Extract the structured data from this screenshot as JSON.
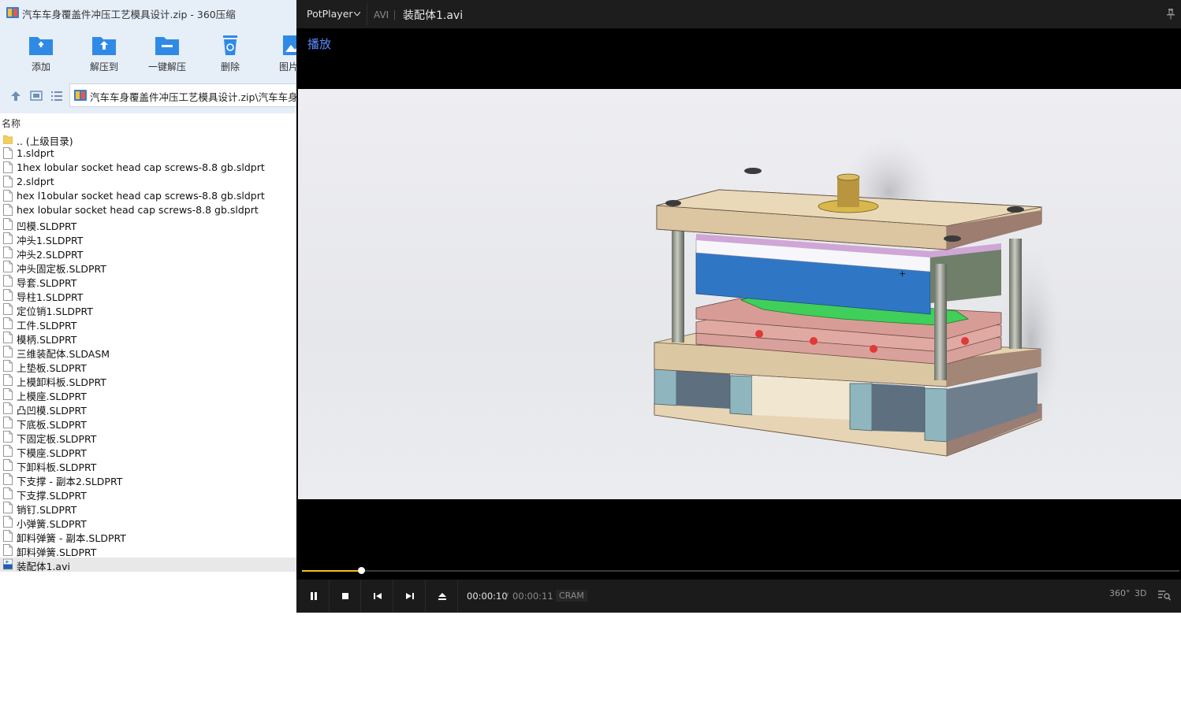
{
  "archive": {
    "title": "汽车车身覆盖件冲压工艺模具设计.zip - 360压缩",
    "toolbar": [
      {
        "label": "添加",
        "icon": "add-folder-icon"
      },
      {
        "label": "解压到",
        "icon": "extract-to-icon"
      },
      {
        "label": "一键解压",
        "icon": "one-click-extract-icon"
      },
      {
        "label": "删除",
        "icon": "delete-icon"
      },
      {
        "label": "图片滤",
        "icon": "image-icon"
      }
    ],
    "path": "汽车车身覆盖件冲压工艺模具设计.zip\\汽车车身覆",
    "column_name": "名称",
    "files": [
      {
        "name": ".. (上级目录)",
        "type": "folder"
      },
      {
        "name": "1.sldprt",
        "type": "file"
      },
      {
        "name": "1hex lobular socket head cap screws-8.8 gb.sldprt",
        "type": "file"
      },
      {
        "name": "2.sldprt",
        "type": "file"
      },
      {
        "name": "hex l1obular socket head cap screws-8.8 gb.sldprt",
        "type": "file"
      },
      {
        "name": "hex lobular socket head cap screws-8.8 gb.sldprt",
        "type": "file"
      },
      {
        "name": "凹模.SLDPRT",
        "type": "file"
      },
      {
        "name": "冲头1.SLDPRT",
        "type": "file"
      },
      {
        "name": "冲头2.SLDPRT",
        "type": "file"
      },
      {
        "name": "冲头固定板.SLDPRT",
        "type": "file"
      },
      {
        "name": "导套.SLDPRT",
        "type": "file"
      },
      {
        "name": "导柱1.SLDPRT",
        "type": "file"
      },
      {
        "name": "定位销1.SLDPRT",
        "type": "file"
      },
      {
        "name": "工件.SLDPRT",
        "type": "file"
      },
      {
        "name": "模柄.SLDPRT",
        "type": "file"
      },
      {
        "name": "三维装配体.SLDASM",
        "type": "file"
      },
      {
        "name": "上垫板.SLDPRT",
        "type": "file"
      },
      {
        "name": "上模卸料板.SLDPRT",
        "type": "file"
      },
      {
        "name": "上模座.SLDPRT",
        "type": "file"
      },
      {
        "name": "凸凹模.SLDPRT",
        "type": "file"
      },
      {
        "name": "下底板.SLDPRT",
        "type": "file"
      },
      {
        "name": "下固定板.SLDPRT",
        "type": "file"
      },
      {
        "name": "下模座.SLDPRT",
        "type": "file"
      },
      {
        "name": "下卸料板.SLDPRT",
        "type": "file"
      },
      {
        "name": "下支撑 - 副本2.SLDPRT",
        "type": "file"
      },
      {
        "name": "下支撑.SLDPRT",
        "type": "file"
      },
      {
        "name": "销钉.SLDPRT",
        "type": "file"
      },
      {
        "name": "小弹簧.SLDPRT",
        "type": "file"
      },
      {
        "name": "卸料弹簧 - 副本.SLDPRT",
        "type": "file"
      },
      {
        "name": "卸料弹簧.SLDPRT",
        "type": "file"
      },
      {
        "name": "装配体1.avi",
        "type": "avi",
        "selected": true
      }
    ]
  },
  "player": {
    "brand": "PotPlayer",
    "format": "AVI",
    "filename": "装配体1.avi",
    "overlay": "播放",
    "time_current": "00:00:10",
    "time_separator": "/",
    "time_total": "00:00:11",
    "codec": "CRAM",
    "progress": 0.067,
    "right_buttons": {
      "vr": "360°",
      "three_d": "3D"
    },
    "video_cursor_mark": "+"
  },
  "colors": {
    "accent_seek": "#f3c11a",
    "overlay_text": "#5a8cff",
    "archive_chrome": "#e6eef8"
  }
}
